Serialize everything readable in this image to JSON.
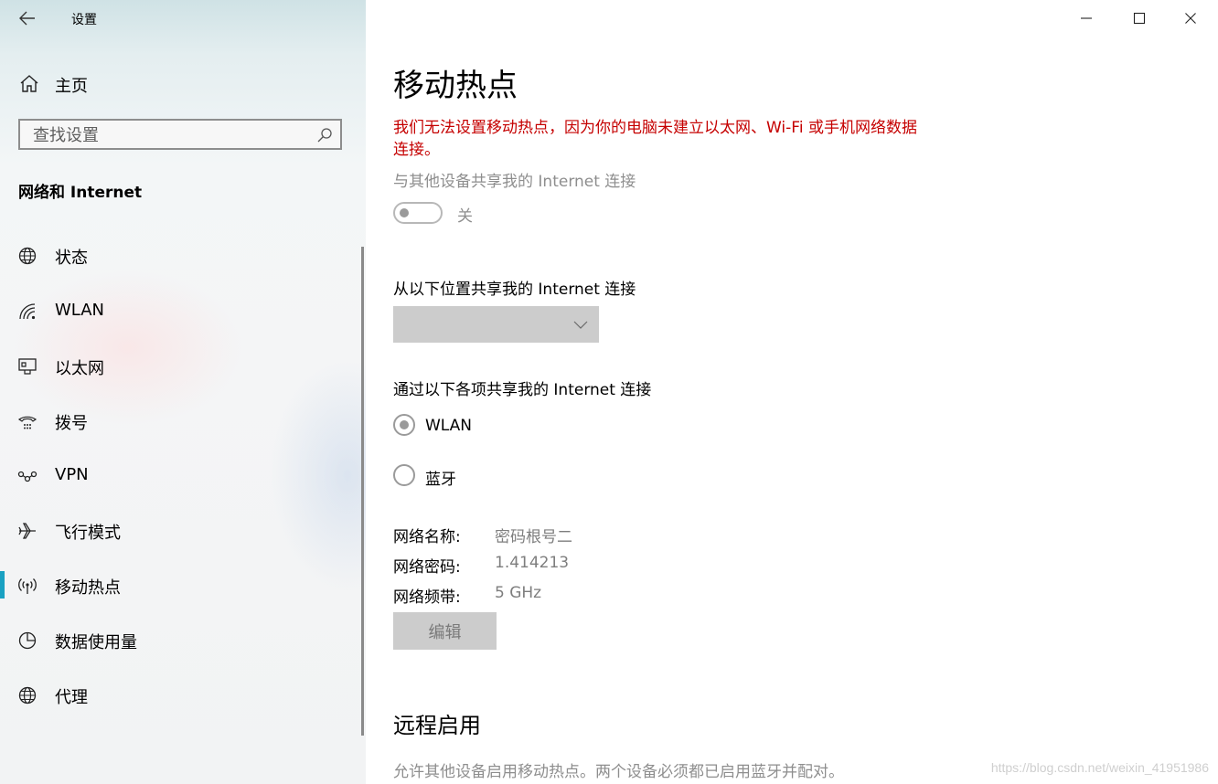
{
  "window": {
    "title": "设置",
    "controls": {
      "minimize": "minimize-icon",
      "maximize": "maximize-icon",
      "close": "close-icon"
    }
  },
  "sidebar": {
    "home_label": "主页",
    "search_placeholder": "查找设置",
    "section_title": "网络和 Internet",
    "items": [
      {
        "label": "状态",
        "icon": "globe-status-icon"
      },
      {
        "label": "WLAN",
        "icon": "wifi-icon"
      },
      {
        "label": "以太网",
        "icon": "ethernet-icon"
      },
      {
        "label": "拨号",
        "icon": "dialup-icon"
      },
      {
        "label": "VPN",
        "icon": "vpn-icon"
      },
      {
        "label": "飞行模式",
        "icon": "airplane-icon"
      },
      {
        "label": "移动热点",
        "icon": "hotspot-icon",
        "active": true
      },
      {
        "label": "数据使用量",
        "icon": "data-usage-icon"
      },
      {
        "label": "代理",
        "icon": "globe-proxy-icon"
      }
    ],
    "accent_color": "#1aa1c2"
  },
  "main": {
    "title": "移动热点",
    "error": "我们无法设置移动热点，因为你的电脑未建立以太网、Wi-Fi 或手机网络数据连接。",
    "error_color": "#c50000",
    "share_label": "与其他设备共享我的 Internet 连接",
    "toggle_state": "关",
    "toggle_on": false,
    "from_label": "从以下位置共享我的 Internet 连接",
    "from_value": "",
    "via_label": "通过以下各项共享我的 Internet 连接",
    "via_options": [
      {
        "label": "WLAN",
        "selected": true
      },
      {
        "label": "蓝牙",
        "selected": false
      }
    ],
    "network": {
      "name_key": "网络名称:",
      "name_val": "密码根号二",
      "password_key": "网络密码:",
      "password_val": "1.414213",
      "band_key": "网络频带:",
      "band_val": "5 GHz"
    },
    "edit_button": "编辑",
    "remote_title": "远程启用",
    "remote_desc": "允许其他设备启用移动热点。两个设备必须都已启用蓝牙并配对。"
  },
  "watermark": "https://blog.csdn.net/weixin_41951986"
}
